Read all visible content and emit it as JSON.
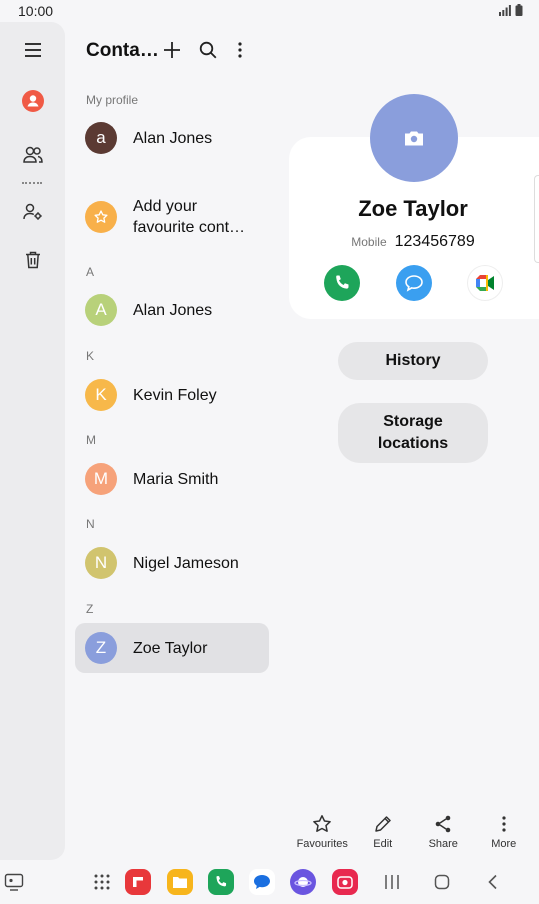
{
  "status_bar": {
    "time": "10:00"
  },
  "list": {
    "title": "Conta…",
    "my_profile_label": "My profile",
    "profile": {
      "initial": "a",
      "name": "Alan Jones",
      "color": "#5b3a33"
    },
    "favourites": {
      "text": "Add your\nfavourite cont…",
      "color": "#f8b04a"
    },
    "sections": [
      {
        "letter": "A",
        "contacts": [
          {
            "initial": "A",
            "name": "Alan Jones",
            "color": "#b8d17a"
          }
        ]
      },
      {
        "letter": "K",
        "contacts": [
          {
            "initial": "K",
            "name": "Kevin Foley",
            "color": "#f7b84a"
          }
        ]
      },
      {
        "letter": "M",
        "contacts": [
          {
            "initial": "M",
            "name": "Maria Smith",
            "color": "#f6a27a"
          }
        ]
      },
      {
        "letter": "N",
        "contacts": [
          {
            "initial": "N",
            "name": "Nigel Jameson",
            "color": "#d1c46e"
          }
        ]
      },
      {
        "letter": "Z",
        "contacts": [
          {
            "initial": "Z",
            "name": "Zoe Taylor",
            "color": "#8a9edc",
            "selected": true
          }
        ]
      }
    ]
  },
  "detail": {
    "name": "Zoe Taylor",
    "phone_type": "Mobile",
    "phone_number": "123456789",
    "history_label": "History",
    "storage_label": "Storage\nlocations"
  },
  "toolbar": {
    "favourites": "Favourites",
    "edit": "Edit",
    "share": "Share",
    "more": "More"
  },
  "colors": {
    "call": "#1ea55a",
    "message": "#3a9ff0",
    "accent_profile": "#f05a45"
  }
}
